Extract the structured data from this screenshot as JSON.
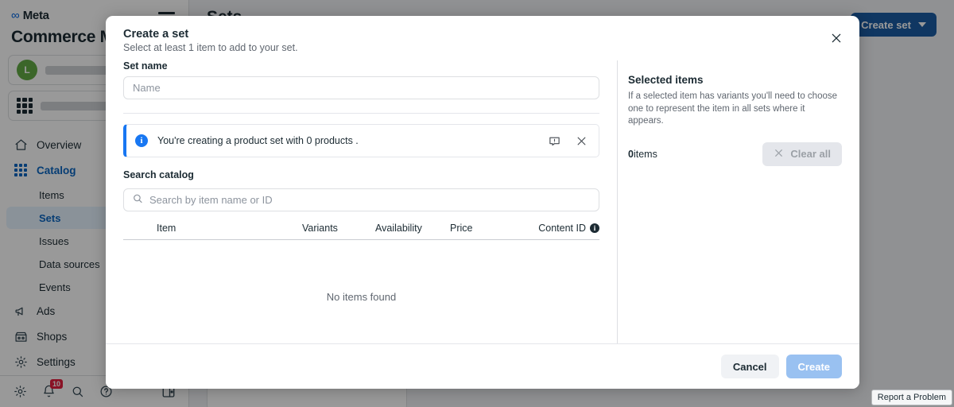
{
  "app": {
    "brand": "Meta",
    "title": "Commerce Manager",
    "page_title": "Sets",
    "create_set_label": "Create set",
    "report_problem": "Report a Problem",
    "notification_count": "10"
  },
  "sidebar": {
    "items": [
      {
        "label": "Overview",
        "icon": "home-icon"
      },
      {
        "label": "Catalog",
        "icon": "grid-icon"
      },
      {
        "label": "Ads",
        "icon": "megaphone-icon"
      },
      {
        "label": "Shops",
        "icon": "shop-icon"
      },
      {
        "label": "Settings",
        "icon": "gear-icon"
      }
    ],
    "catalog_children": [
      {
        "label": "Items"
      },
      {
        "label": "Sets"
      },
      {
        "label": "Issues"
      },
      {
        "label": "Data sources"
      },
      {
        "label": "Events"
      }
    ],
    "avatar_letter": "L",
    "bottom_icons": [
      "gear-icon",
      "bell-icon",
      "search-icon",
      "help-icon",
      "panel-toggle-icon"
    ]
  },
  "modal": {
    "title": "Create a set",
    "subtitle": "Select at least 1 item to add to your set.",
    "set_name_label": "Set name",
    "set_name_value": "",
    "set_name_placeholder": "Name",
    "banner_text": "You're creating a product set with 0 products .",
    "search_label": "Search catalog",
    "search_value": "",
    "search_placeholder": "Search by item name or ID",
    "table_headers": [
      "Item",
      "Variants",
      "Availability",
      "Price",
      "Content ID"
    ],
    "empty_message": "No items found",
    "right_panel": {
      "title": "Selected items",
      "description": "If a selected item has variants you'll need to choose one to represent the item in all sets where it appears.",
      "count": "0",
      "count_unit": "items",
      "clear_all_label": "Clear all"
    },
    "cancel_label": "Cancel",
    "create_label": "Create"
  },
  "colors": {
    "brand_blue": "#0064e0",
    "accent_blue": "#1877f2",
    "primary_button": "#1b5ca4",
    "active_nav": "#0a66c2",
    "avatar_green": "#63ab45",
    "badge_red": "#e41e3f"
  }
}
